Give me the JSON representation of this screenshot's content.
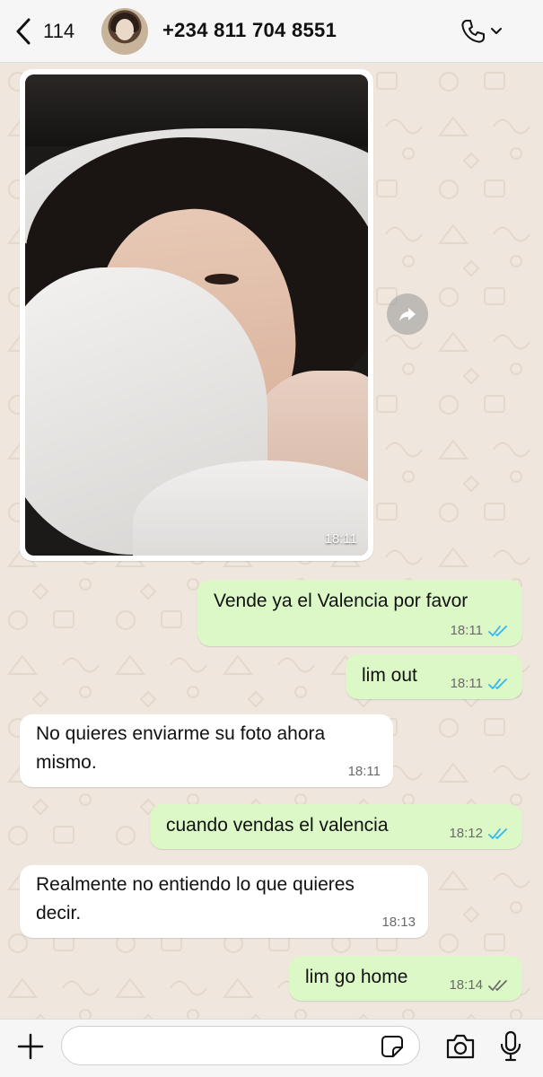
{
  "header": {
    "back_count": "114",
    "contact_name": "+234 811 704 8551",
    "icons": {
      "back": "chevron-left-icon",
      "call": "phone-icon",
      "call_menu": "chevron-down-icon"
    }
  },
  "messages": {
    "photo": {
      "time": "18:11"
    },
    "m1": {
      "text": "Vende ya el Valencia por favor",
      "time": "18:11"
    },
    "m2": {
      "text": "lim out",
      "time": "18:11"
    },
    "m3": {
      "text_line1": "No quieres enviarme su foto ahora",
      "text_line2": "mismo.",
      "time": "18:11"
    },
    "m4": {
      "text": "cuando vendas el valencia",
      "time": "18:12"
    },
    "m5": {
      "text_line1": "Realmente no entiendo lo que quieres",
      "text_line2": "decir.",
      "time": "18:13"
    },
    "m6": {
      "text": "lim go home",
      "time": "18:14"
    }
  },
  "composer": {
    "value": "",
    "placeholder": "",
    "icons": {
      "attach": "plus-icon",
      "sticker": "sticker-icon",
      "camera": "camera-icon",
      "mic": "microphone-icon"
    }
  },
  "colors": {
    "outgoing_bubble": "#dcf8c6",
    "incoming_bubble": "#ffffff",
    "read_ticks": "#34b7f1",
    "delivered_ticks": "#6a6a6a",
    "chat_background": "#efe7dd"
  }
}
